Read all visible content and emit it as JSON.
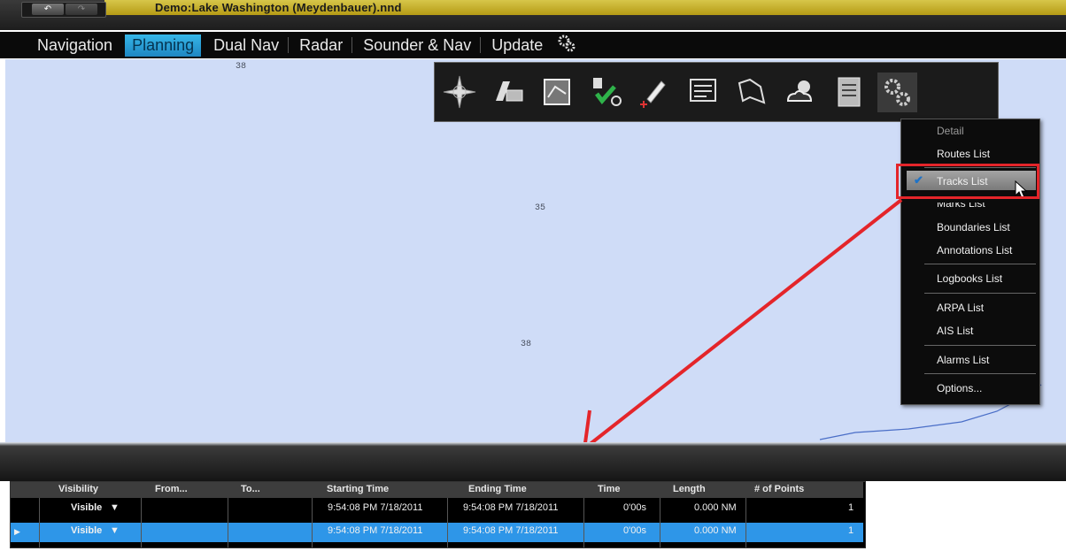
{
  "window": {
    "title": "Demo:Lake Washington (Meydenbauer).nnd",
    "undo_label": "↶",
    "redo_label": "↷"
  },
  "tabs": [
    {
      "label": "Navigation"
    },
    {
      "label": "Planning"
    },
    {
      "label": "Dual Nav"
    },
    {
      "label": "Radar"
    },
    {
      "label": "Sounder & Nav"
    },
    {
      "label": "Update"
    }
  ],
  "map": {
    "depths": [
      "38",
      "35",
      "38"
    ]
  },
  "toolbar": {
    "icons": [
      "compass-icon",
      "chart-stack-icon",
      "map-frame-icon",
      "route-check-icon",
      "pencil-mark-icon",
      "list-icon",
      "flag-icon",
      "weather-icon",
      "document-icon",
      "gears-icon"
    ]
  },
  "menu": {
    "items": [
      {
        "label": "Detail"
      },
      {
        "label": "Routes List"
      },
      {
        "label": "Tracks List"
      },
      {
        "label": "Marks List"
      },
      {
        "label": "Boundaries List"
      },
      {
        "label": "Annotations List"
      },
      {
        "label": "Logbooks List"
      },
      {
        "label": "ARPA List"
      },
      {
        "label": "AIS List"
      },
      {
        "label": "Alarms List"
      },
      {
        "label": "Options..."
      }
    ],
    "checked": "Tracks List"
  },
  "table": {
    "headers": [
      "Visibility",
      "From...",
      "To...",
      "Starting Time",
      "Ending Time",
      "Time",
      "Length",
      "# of Points"
    ],
    "rows": [
      {
        "visibility": "Visible",
        "from": "",
        "to": "",
        "start": "9:54:08 PM 7/18/2011",
        "end": "9:54:08 PM 7/18/2011",
        "time": "0'00s",
        "length": "0.000 NM",
        "points": "1"
      },
      {
        "visibility": "Visible",
        "from": "",
        "to": "",
        "start": "9:54:08 PM 7/18/2011",
        "end": "9:54:08 PM 7/18/2011",
        "time": "0'00s",
        "length": "0.000 NM",
        "points": "1"
      }
    ]
  },
  "colors": {
    "accent": "#2e96e8",
    "highlight_box": "#e4252a",
    "map_water": "#cfdcf7"
  }
}
